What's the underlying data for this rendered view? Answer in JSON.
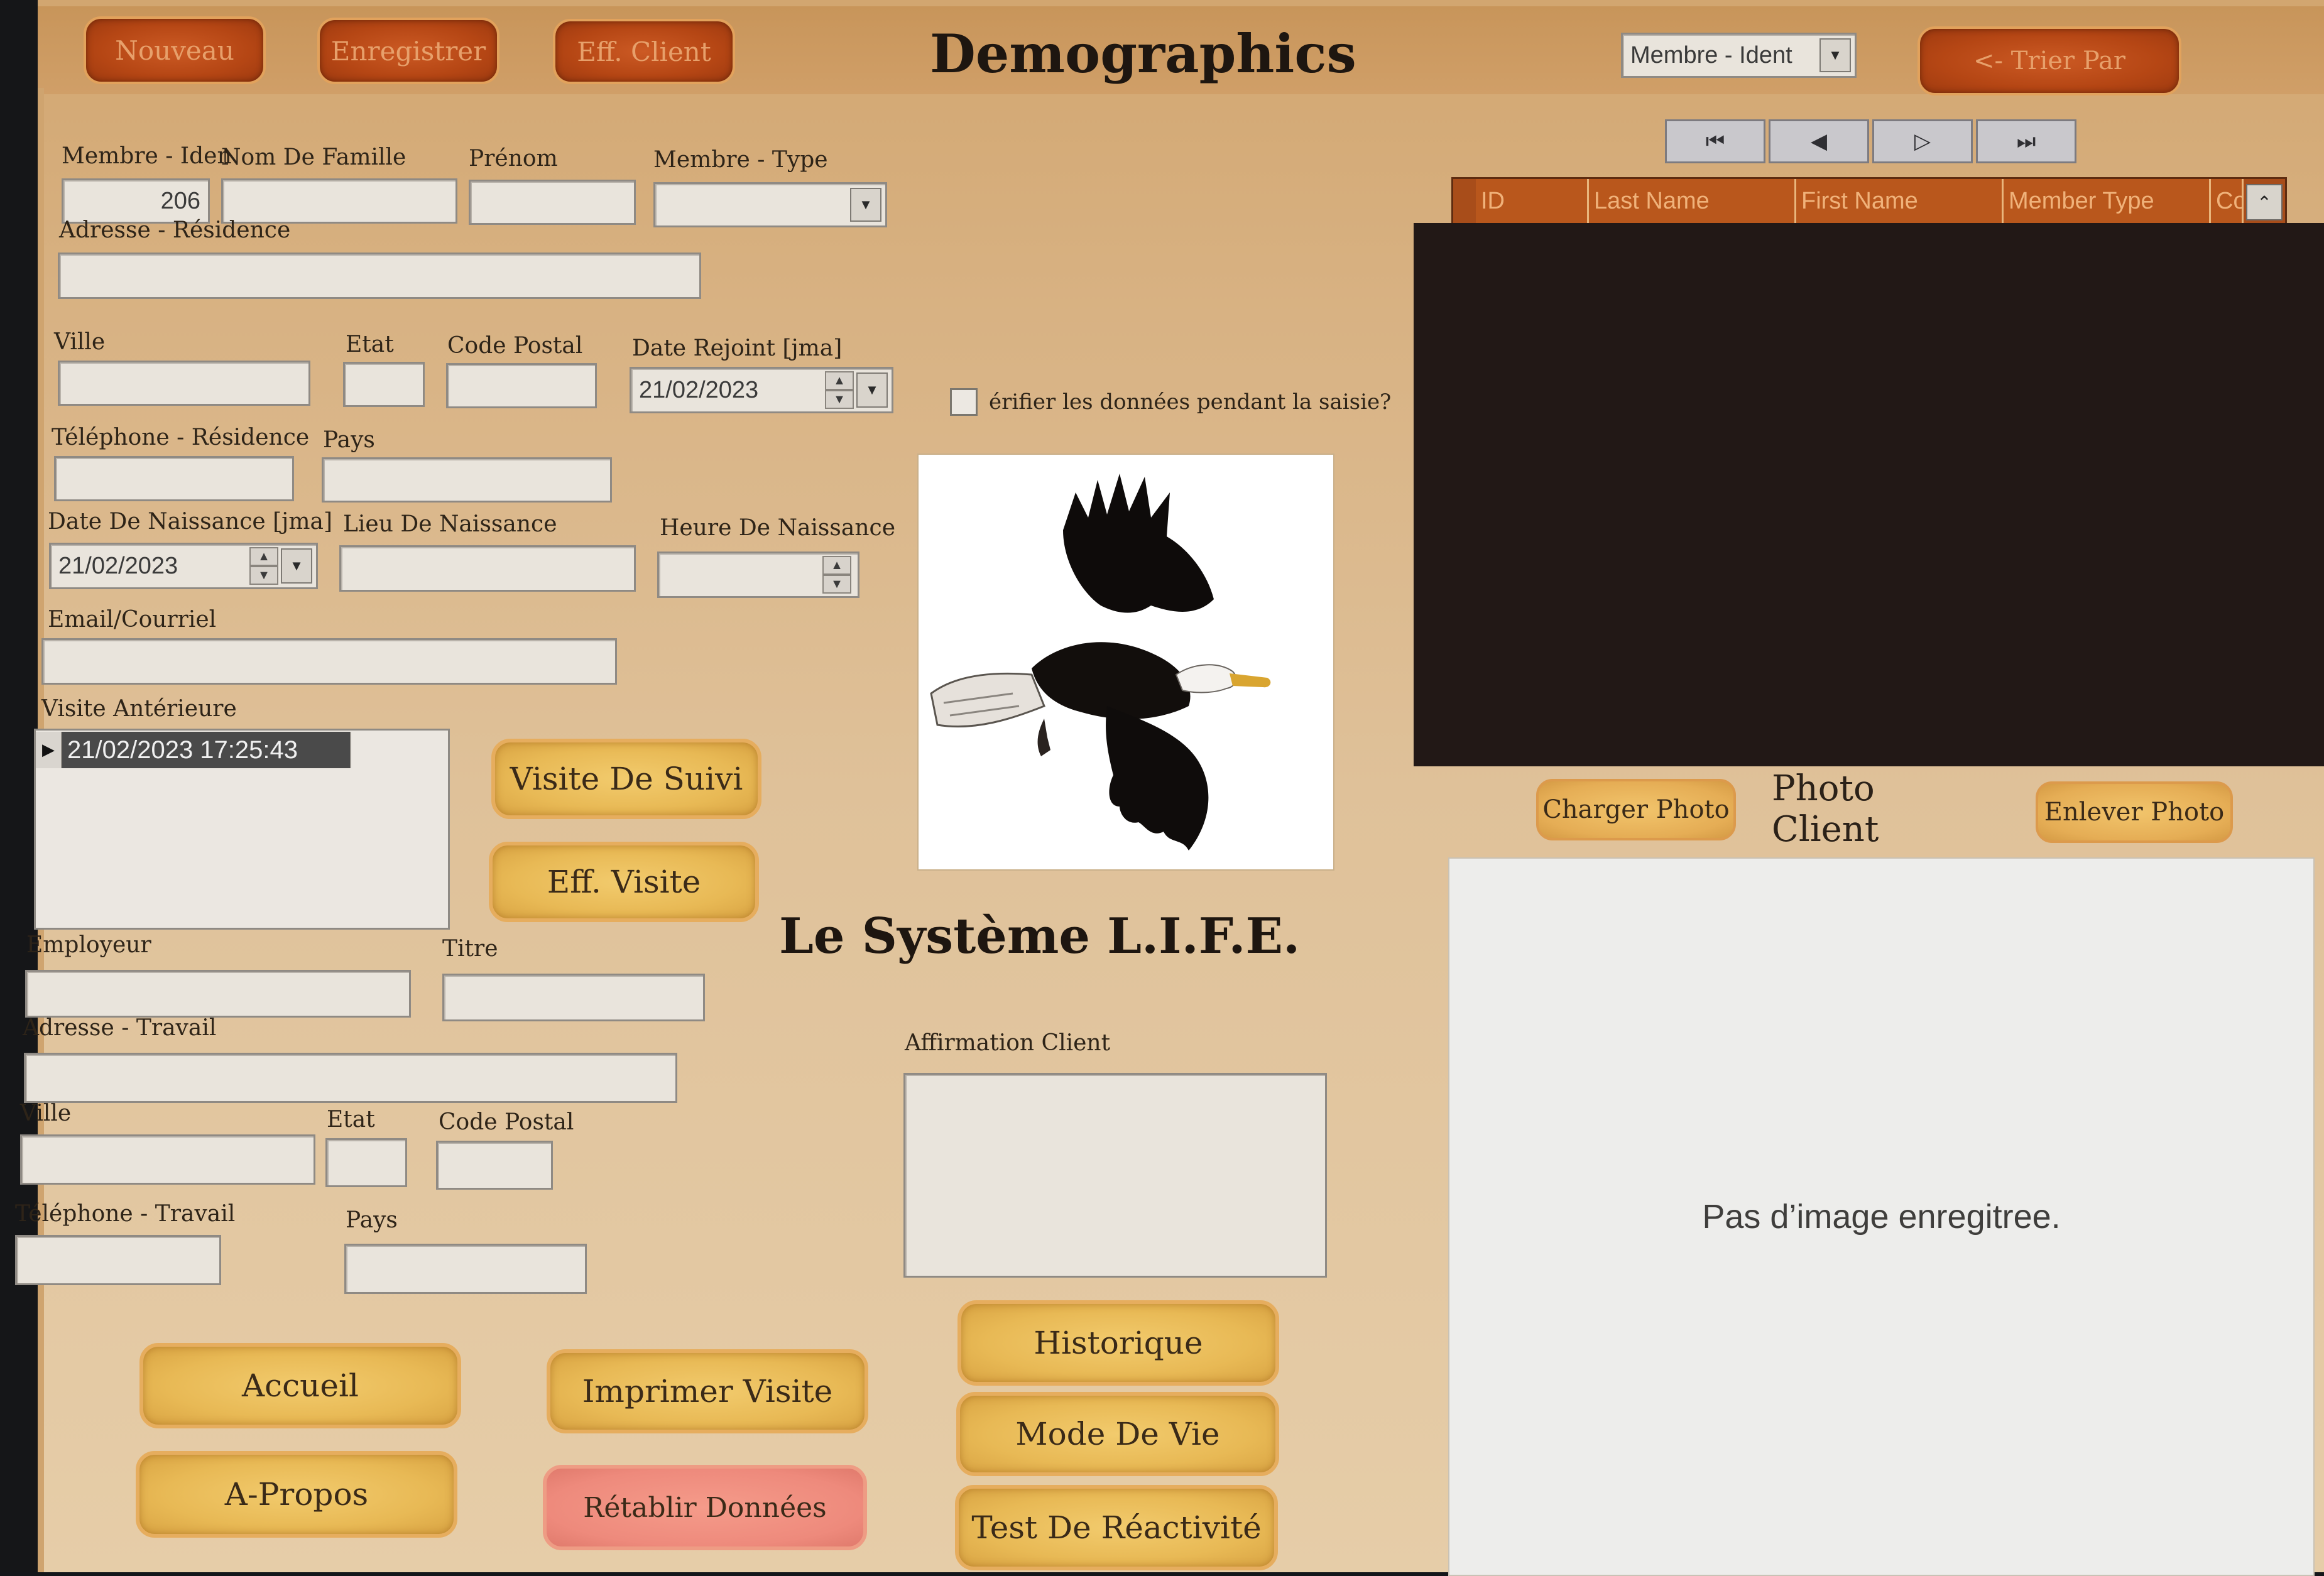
{
  "toolbar": {
    "nouveau": "Nouveau",
    "enregistrer": "Enregistrer",
    "eff_client": "Eff. Client",
    "title": "Demographics",
    "sort_select_value": "Membre - Ident",
    "trier_par": "<- Trier Par"
  },
  "nav": {
    "first": "first-record-icon",
    "prev": "prev-record-icon",
    "next": "next-record-icon",
    "last": "last-record-icon"
  },
  "grid": {
    "columns": [
      "ID",
      "Last Name",
      "First Name",
      "Member Type",
      "Co"
    ]
  },
  "form": {
    "membre_iden_label": "Membre - Iden",
    "membre_iden_value": "206",
    "nom_label": "Nom De Famille",
    "prenom_label": "Prénom",
    "membre_type_label": "Membre - Type",
    "adresse_res_label": "Adresse - Résidence",
    "ville_label": "Ville",
    "etat_label": "Etat",
    "code_postal_label": "Code Postal",
    "date_rejoint_label": "Date Rejoint [jma]",
    "date_rejoint_value": "21/02/2023",
    "verify_label": "érifier les données pendant la saisie?",
    "tel_res_label": "Téléphone - Résidence",
    "pays_label": "Pays",
    "date_naissance_label": "Date De Naissance [jma]",
    "date_naissance_value": "21/02/2023",
    "lieu_naissance_label": "Lieu De Naissance",
    "heure_naissance_label": "Heure De Naissance",
    "email_label": "Email/Courriel",
    "visite_anterieure_label": "Visite Antérieure",
    "visite_anterieure_row": "21/02/2023 17:25:43",
    "employeur_label": "Employeur",
    "titre_label": "Titre",
    "adresse_trav_label": "Adresse - Travail",
    "ville2_label": "Ville",
    "etat2_label": "Etat",
    "code_postal2_label": "Code Postal",
    "tel_trav_label": "Téléphone - Travail",
    "pays2_label": "Pays",
    "affirmation_label": "Affirmation Client"
  },
  "center": {
    "visite_suivi": "Visite De Suivi",
    "eff_visite": "Eff. Visite",
    "system_title": "Le Système L.I.F.E.",
    "eagle_image": "eagle-image"
  },
  "photo": {
    "charger": "Charger Photo",
    "title": "Photo Client",
    "enlever": "Enlever Photo",
    "placeholder": "Pas d’image enregitree."
  },
  "bottom": {
    "accueil": "Accueil",
    "a_propos": "A-Propos",
    "imprimer_visite": "Imprimer Visite",
    "retablir": "Rétablir Données",
    "historique": "Historique",
    "mode_de_vie": "Mode De Vie",
    "test_reactivite": "Test De Réactivité"
  },
  "colors": {
    "dark_button": "#b54614",
    "gold_button": "#e8b955",
    "pink_button": "#ee8a7c",
    "grid_body": "#221816",
    "background": "#dfc199"
  }
}
